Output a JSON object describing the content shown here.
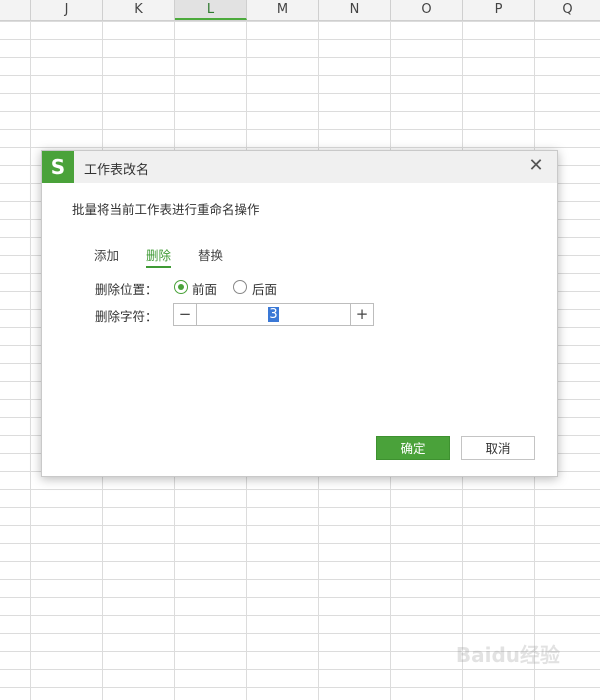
{
  "spreadsheet": {
    "columns": [
      {
        "label": "J"
      },
      {
        "label": "K"
      },
      {
        "label": "L"
      },
      {
        "label": "M"
      },
      {
        "label": "N"
      },
      {
        "label": "O"
      },
      {
        "label": "P"
      },
      {
        "label": "Q"
      }
    ],
    "active_column": "L",
    "colors": {
      "accent": "#4caa3c",
      "header_bg": "#f3f3f3",
      "grid_line": "#dcdcdc"
    }
  },
  "dialog": {
    "title": "工作表改名",
    "logo_letter": "S",
    "close_icon": "close-icon",
    "description": "批量将当前工作表进行重命名操作",
    "tabs": [
      {
        "label": "添加",
        "active": false
      },
      {
        "label": "删除",
        "active": true
      },
      {
        "label": "替换",
        "active": false
      }
    ],
    "position_label": "删除位置：",
    "position_options": [
      {
        "label": "前面",
        "checked": true
      },
      {
        "label": "后面",
        "checked": false
      }
    ],
    "chars_label": "删除字符：",
    "chars_value": "3",
    "minus_symbol": "−",
    "plus_symbol": "+",
    "ok_label": "确定",
    "cancel_label": "取消",
    "colors": {
      "primary": "#4aa23a",
      "titlebar": "#f0f0f0"
    }
  },
  "watermark": "Baidu经验"
}
